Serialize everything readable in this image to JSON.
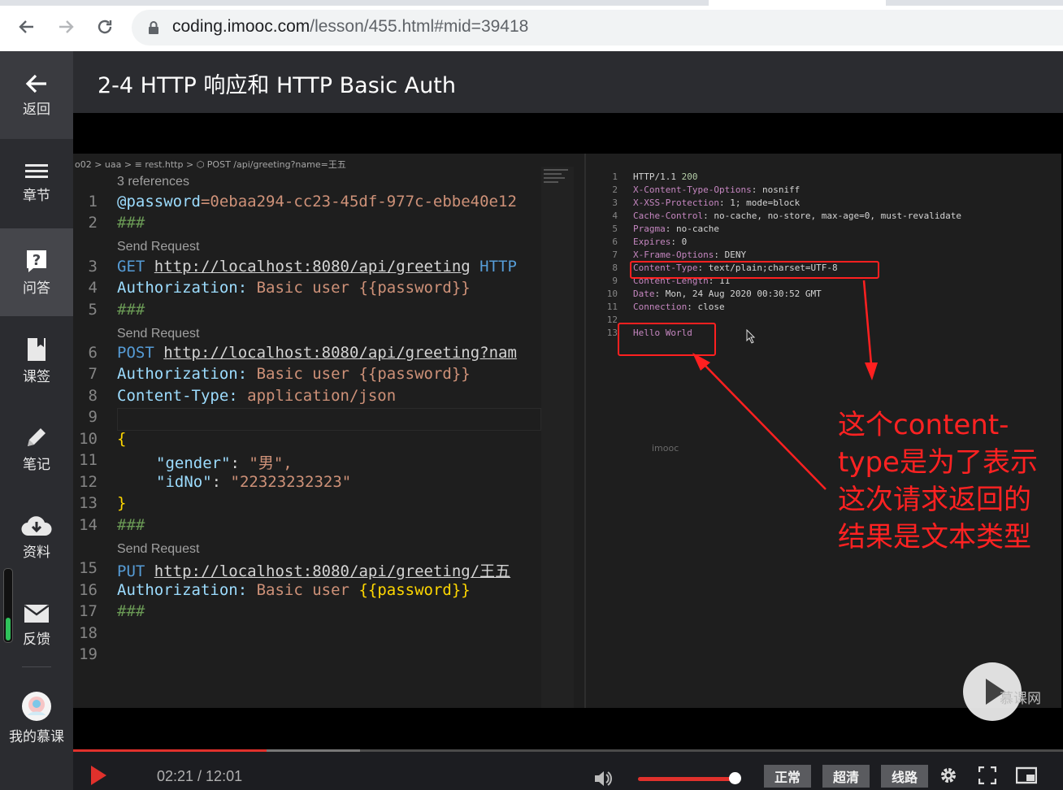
{
  "browser": {
    "url_host": "coding.imooc.com",
    "url_path": "/lesson/455.html#mid=39418"
  },
  "sidebar": {
    "back": "返回",
    "chapters": "章节",
    "qa": "问答",
    "bookmarks": "课签",
    "notes": "笔记",
    "resources": "资料",
    "feedback": "反馈",
    "my_courses": "我的慕课"
  },
  "lesson": {
    "title": "2-4 HTTP 响应和 HTTP Basic Auth"
  },
  "editor": {
    "breadcrumb": "o02 > uaa > ≡ rest.http > ⬡ POST /api/greeting?name=王五",
    "lens_refs": "3 references",
    "lens_send": "Send Request",
    "lines": {
      "l1_var": "@password",
      "l1_val": "=0ebaa294-cc23-45df-977c-ebbe40e12",
      "sep": "###",
      "l3_method": "GET",
      "l3_url": "http://localhost:8080/api/greeting",
      "l3_ver": " HTTP",
      "auth_key": "Authorization:",
      "auth_val": " Basic user ",
      "auth_tpl": "{{password}}",
      "l6_method": "POST",
      "l6_url": "http://localhost:8080/api/greeting?nam",
      "ct_key": "Content-Type:",
      "ct_val": " application/json",
      "open_brace": "{",
      "gender_key": "\"gender\"",
      "gender_val": "\"男\",",
      "idno_key": "\"idNo\"",
      "idno_val": "\"22323232323\"",
      "close_brace": "}",
      "l15_method": "PUT",
      "l15_url": "http://localhost:8080/api/greeting/王五"
    },
    "line_numbers": [
      "1",
      "2",
      "3",
      "4",
      "5",
      "6",
      "7",
      "8",
      "9",
      "10",
      "11",
      "12",
      "13",
      "14",
      "15",
      "16",
      "17",
      "18",
      "19"
    ]
  },
  "response": {
    "lines": [
      {
        "n": "1",
        "k": "HTTP/1.1",
        "v": " 200"
      },
      {
        "n": "2",
        "k": "X-Content-Type-Options",
        "v": ": nosniff"
      },
      {
        "n": "3",
        "k": "X-XSS-Protection",
        "v": ": 1; mode=block"
      },
      {
        "n": "4",
        "k": "Cache-Control",
        "v": ": no-cache, no-store, max-age=0, must-revalidate"
      },
      {
        "n": "5",
        "k": "Pragma",
        "v": ": no-cache"
      },
      {
        "n": "6",
        "k": "Expires",
        "v": ": 0"
      },
      {
        "n": "7",
        "k": "X-Frame-Options",
        "v": ": DENY"
      },
      {
        "n": "8",
        "k": "Content-Type",
        "v": ": text/plain;charset=UTF-8"
      },
      {
        "n": "9",
        "k": "Content-Length",
        "v": ": 11"
      },
      {
        "n": "10",
        "k": "Date",
        "v": ": Mon, 24 Aug 2020 00:30:52 GMT"
      },
      {
        "n": "11",
        "k": "Connection",
        "v": ": close"
      },
      {
        "n": "12",
        "k": "",
        "v": ""
      },
      {
        "n": "13",
        "k": "Hello World",
        "v": ""
      }
    ],
    "watermark": "imooc"
  },
  "annotation": "这个content-type是为了表示这次请求返回的结果是文本类型",
  "brand": "慕课网",
  "player": {
    "time": "02:21 / 12:01",
    "played_fraction": 0.195,
    "buffered_fraction": 0.29,
    "volume_fraction": 1.0,
    "quality_normal": "正常",
    "quality_hd": "超清",
    "route": "线路"
  },
  "colors": {
    "accent": "#e0312c",
    "annotation": "#ff2222"
  }
}
